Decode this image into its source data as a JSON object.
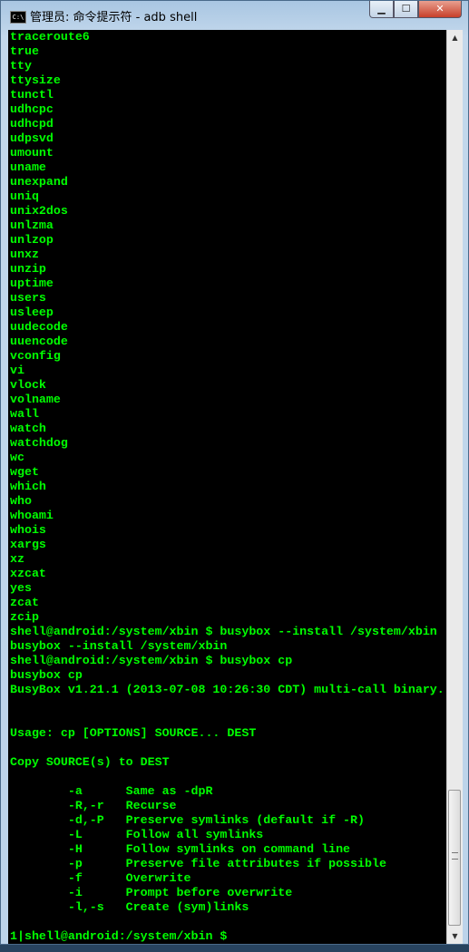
{
  "window": {
    "title": "管理员: 命令提示符 - adb  shell",
    "icon": "cmd-icon",
    "icon_text": "C:\\"
  },
  "controls": {
    "minimize": "▁",
    "maximize": "☐",
    "close": "✕"
  },
  "console": {
    "text_color": "#00ff00",
    "background": "#000000",
    "lines": [
      "traceroute6",
      "true",
      "tty",
      "ttysize",
      "tunctl",
      "udhcpc",
      "udhcpd",
      "udpsvd",
      "umount",
      "uname",
      "unexpand",
      "uniq",
      "unix2dos",
      "unlzma",
      "unlzop",
      "unxz",
      "unzip",
      "uptime",
      "users",
      "usleep",
      "uudecode",
      "uuencode",
      "vconfig",
      "vi",
      "vlock",
      "volname",
      "wall",
      "watch",
      "watchdog",
      "wc",
      "wget",
      "which",
      "who",
      "whoami",
      "whois",
      "xargs",
      "xz",
      "xzcat",
      "yes",
      "zcat",
      "zcip",
      "shell@android:/system/xbin $ busybox --install /system/xbin",
      "busybox --install /system/xbin",
      "shell@android:/system/xbin $ busybox cp",
      "busybox cp",
      "BusyBox v1.21.1 (2013-07-08 10:26:30 CDT) multi-call binary.",
      "",
      "",
      "Usage: cp [OPTIONS] SOURCE... DEST",
      "",
      "Copy SOURCE(s) to DEST",
      "",
      "        -a      Same as -dpR",
      "        -R,-r   Recurse",
      "        -d,-P   Preserve symlinks (default if -R)",
      "        -L      Follow all symlinks",
      "        -H      Follow symlinks on command line",
      "        -p      Preserve file attributes if possible",
      "        -f      Overwrite",
      "        -i      Prompt before overwrite",
      "        -l,-s   Create (sym)links",
      "",
      "1|shell@android:/system/xbin $"
    ]
  },
  "scrollbar": {
    "up": "▲",
    "down": "▼",
    "position_fraction": 1.0
  }
}
